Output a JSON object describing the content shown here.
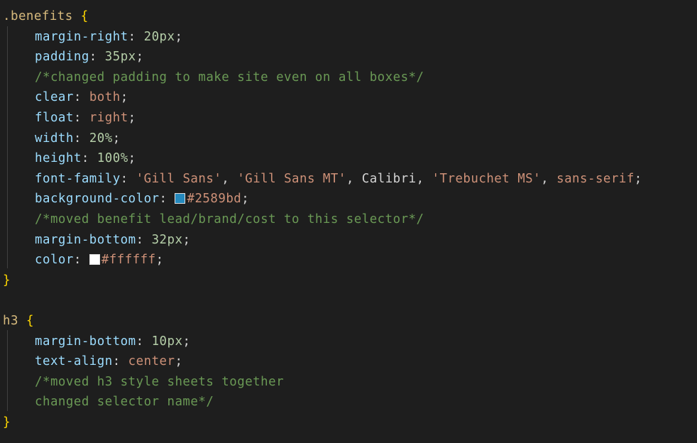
{
  "rule1": {
    "selector": ".benefits",
    "open": "{",
    "close": "}",
    "decls": [
      {
        "prop": "margin-right",
        "value": "20px"
      },
      {
        "prop": "padding",
        "value": "35px"
      },
      {
        "comment": "/*changed padding to make site even on all boxes*/"
      },
      {
        "prop": "clear",
        "value": "both"
      },
      {
        "prop": "float",
        "value": "right"
      },
      {
        "prop": "width",
        "value": "20%"
      },
      {
        "prop": "height",
        "value": "100%"
      }
    ],
    "font_family": {
      "prop": "font-family",
      "v1": "'Gill Sans'",
      "v2": "'Gill Sans MT'",
      "v3": "Calibri",
      "v4": "'Trebuchet MS'",
      "v5": "sans-serif"
    },
    "background": {
      "prop": "background-color",
      "value": "#2589bd",
      "swatch": "#2589bd"
    },
    "comment2": "/*moved benefit lead/brand/cost to this selector*/",
    "margin_bottom": {
      "prop": "margin-bottom",
      "value": "32px"
    },
    "color": {
      "prop": "color",
      "value": "#ffffff",
      "swatch": "#ffffff"
    }
  },
  "rule2": {
    "selector": "h3",
    "open": "{",
    "close": "}",
    "margin_bottom": {
      "prop": "margin-bottom",
      "value": "10px"
    },
    "text_align": {
      "prop": "text-align",
      "value": "center"
    },
    "comment_line1": "/*moved h3 style sheets together",
    "comment_line2": "changed selector name*/"
  },
  "colors": {
    "background": "#1e1e1e",
    "property": "#9cdcfe",
    "number": "#b5cea8",
    "string_keyword": "#ce9178",
    "comment": "#6a9955",
    "selector": "#d7ba7d",
    "bracket": "#ffd700"
  }
}
